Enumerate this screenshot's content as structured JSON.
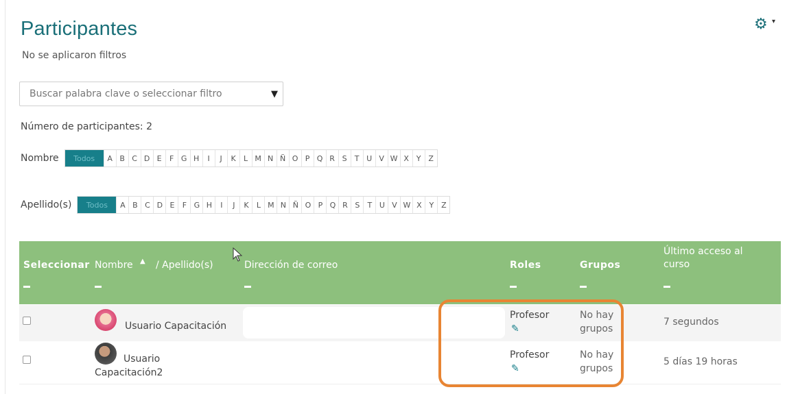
{
  "page": {
    "title": "Participantes",
    "no_filters": "No se aplicaron filtros"
  },
  "search": {
    "placeholder": "Buscar palabra clave o seleccionar filtro",
    "caret": "▼"
  },
  "count_text": "Número de participantes: 2",
  "filters": {
    "firstname_label": "Nombre",
    "lastname_label": "Apellido(s)",
    "all_label": "Todos",
    "letters": [
      "A",
      "B",
      "C",
      "D",
      "E",
      "F",
      "G",
      "H",
      "I",
      "J",
      "K",
      "L",
      "M",
      "N",
      "Ñ",
      "O",
      "P",
      "Q",
      "R",
      "S",
      "T",
      "U",
      "V",
      "W",
      "X",
      "Y",
      "Z"
    ]
  },
  "table": {
    "headers": {
      "select": "Seleccionar",
      "name": "Nombre",
      "sort_icon": "▲",
      "lastname": "/ Apellido(s)",
      "email": "Dirección de correo",
      "roles": "Roles",
      "groups": "Grupos",
      "last_access_line1": "Último acceso al",
      "last_access_line2": "curso"
    },
    "rows": [
      {
        "name": "Usuario Capacitación",
        "role": "Profesor",
        "groups_l1": "No hay",
        "groups_l2": "grupos",
        "last_access": "7 segundos"
      },
      {
        "name_l1": "Usuario",
        "name_l2": "Capacitación2",
        "role": "Profesor",
        "groups_l1": "No hay",
        "groups_l2": "grupos",
        "last_access": "5 días 19 horas"
      }
    ]
  },
  "colors": {
    "accent": "#1a6f78",
    "header_bg": "#8dc07d",
    "highlight": "#e88533"
  }
}
